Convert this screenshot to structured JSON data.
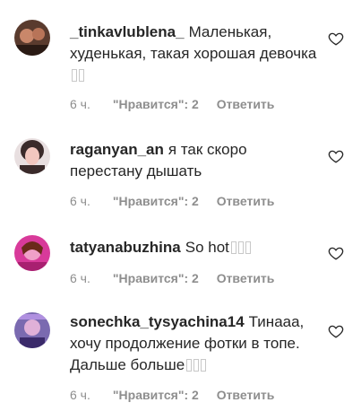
{
  "comments": [
    {
      "username": "_tinkavlublena_",
      "text": "Маленькая, худенькая, такая хорошая девочка",
      "emoji_count": 2,
      "time": "6 ч.",
      "likes": "\"Нравится\": 2",
      "reply": "Ответить",
      "avatar_colors": [
        "#5a3b2e",
        "#c9876a",
        "#2a1a14"
      ]
    },
    {
      "username": "raganyan_an",
      "text": "я так скоро перестану дышать",
      "emoji_count": 0,
      "time": "6 ч.",
      "likes": "\"Нравится\": 2",
      "reply": "Ответить",
      "avatar_colors": [
        "#e8dfe0",
        "#3a2a2a",
        "#f2c7bf"
      ]
    },
    {
      "username": "tatyanabuzhina",
      "text": "So hot",
      "emoji_count": 3,
      "time": "6 ч.",
      "likes": "\"Нравится\": 2",
      "reply": "Ответить",
      "avatar_colors": [
        "#d83a9a",
        "#f0a0c8",
        "#6a2a1a"
      ]
    },
    {
      "username": "sonechka_tysyachina14",
      "text": "Тинааа, хочу продолжение фотки в топе. Дальше больше",
      "emoji_count": 3,
      "time": "6 ч.",
      "likes": "\"Нравится\": 2",
      "reply": "Ответить",
      "avatar_colors": [
        "#7a6ab0",
        "#e0b0d8",
        "#3a2a6a"
      ]
    }
  ]
}
